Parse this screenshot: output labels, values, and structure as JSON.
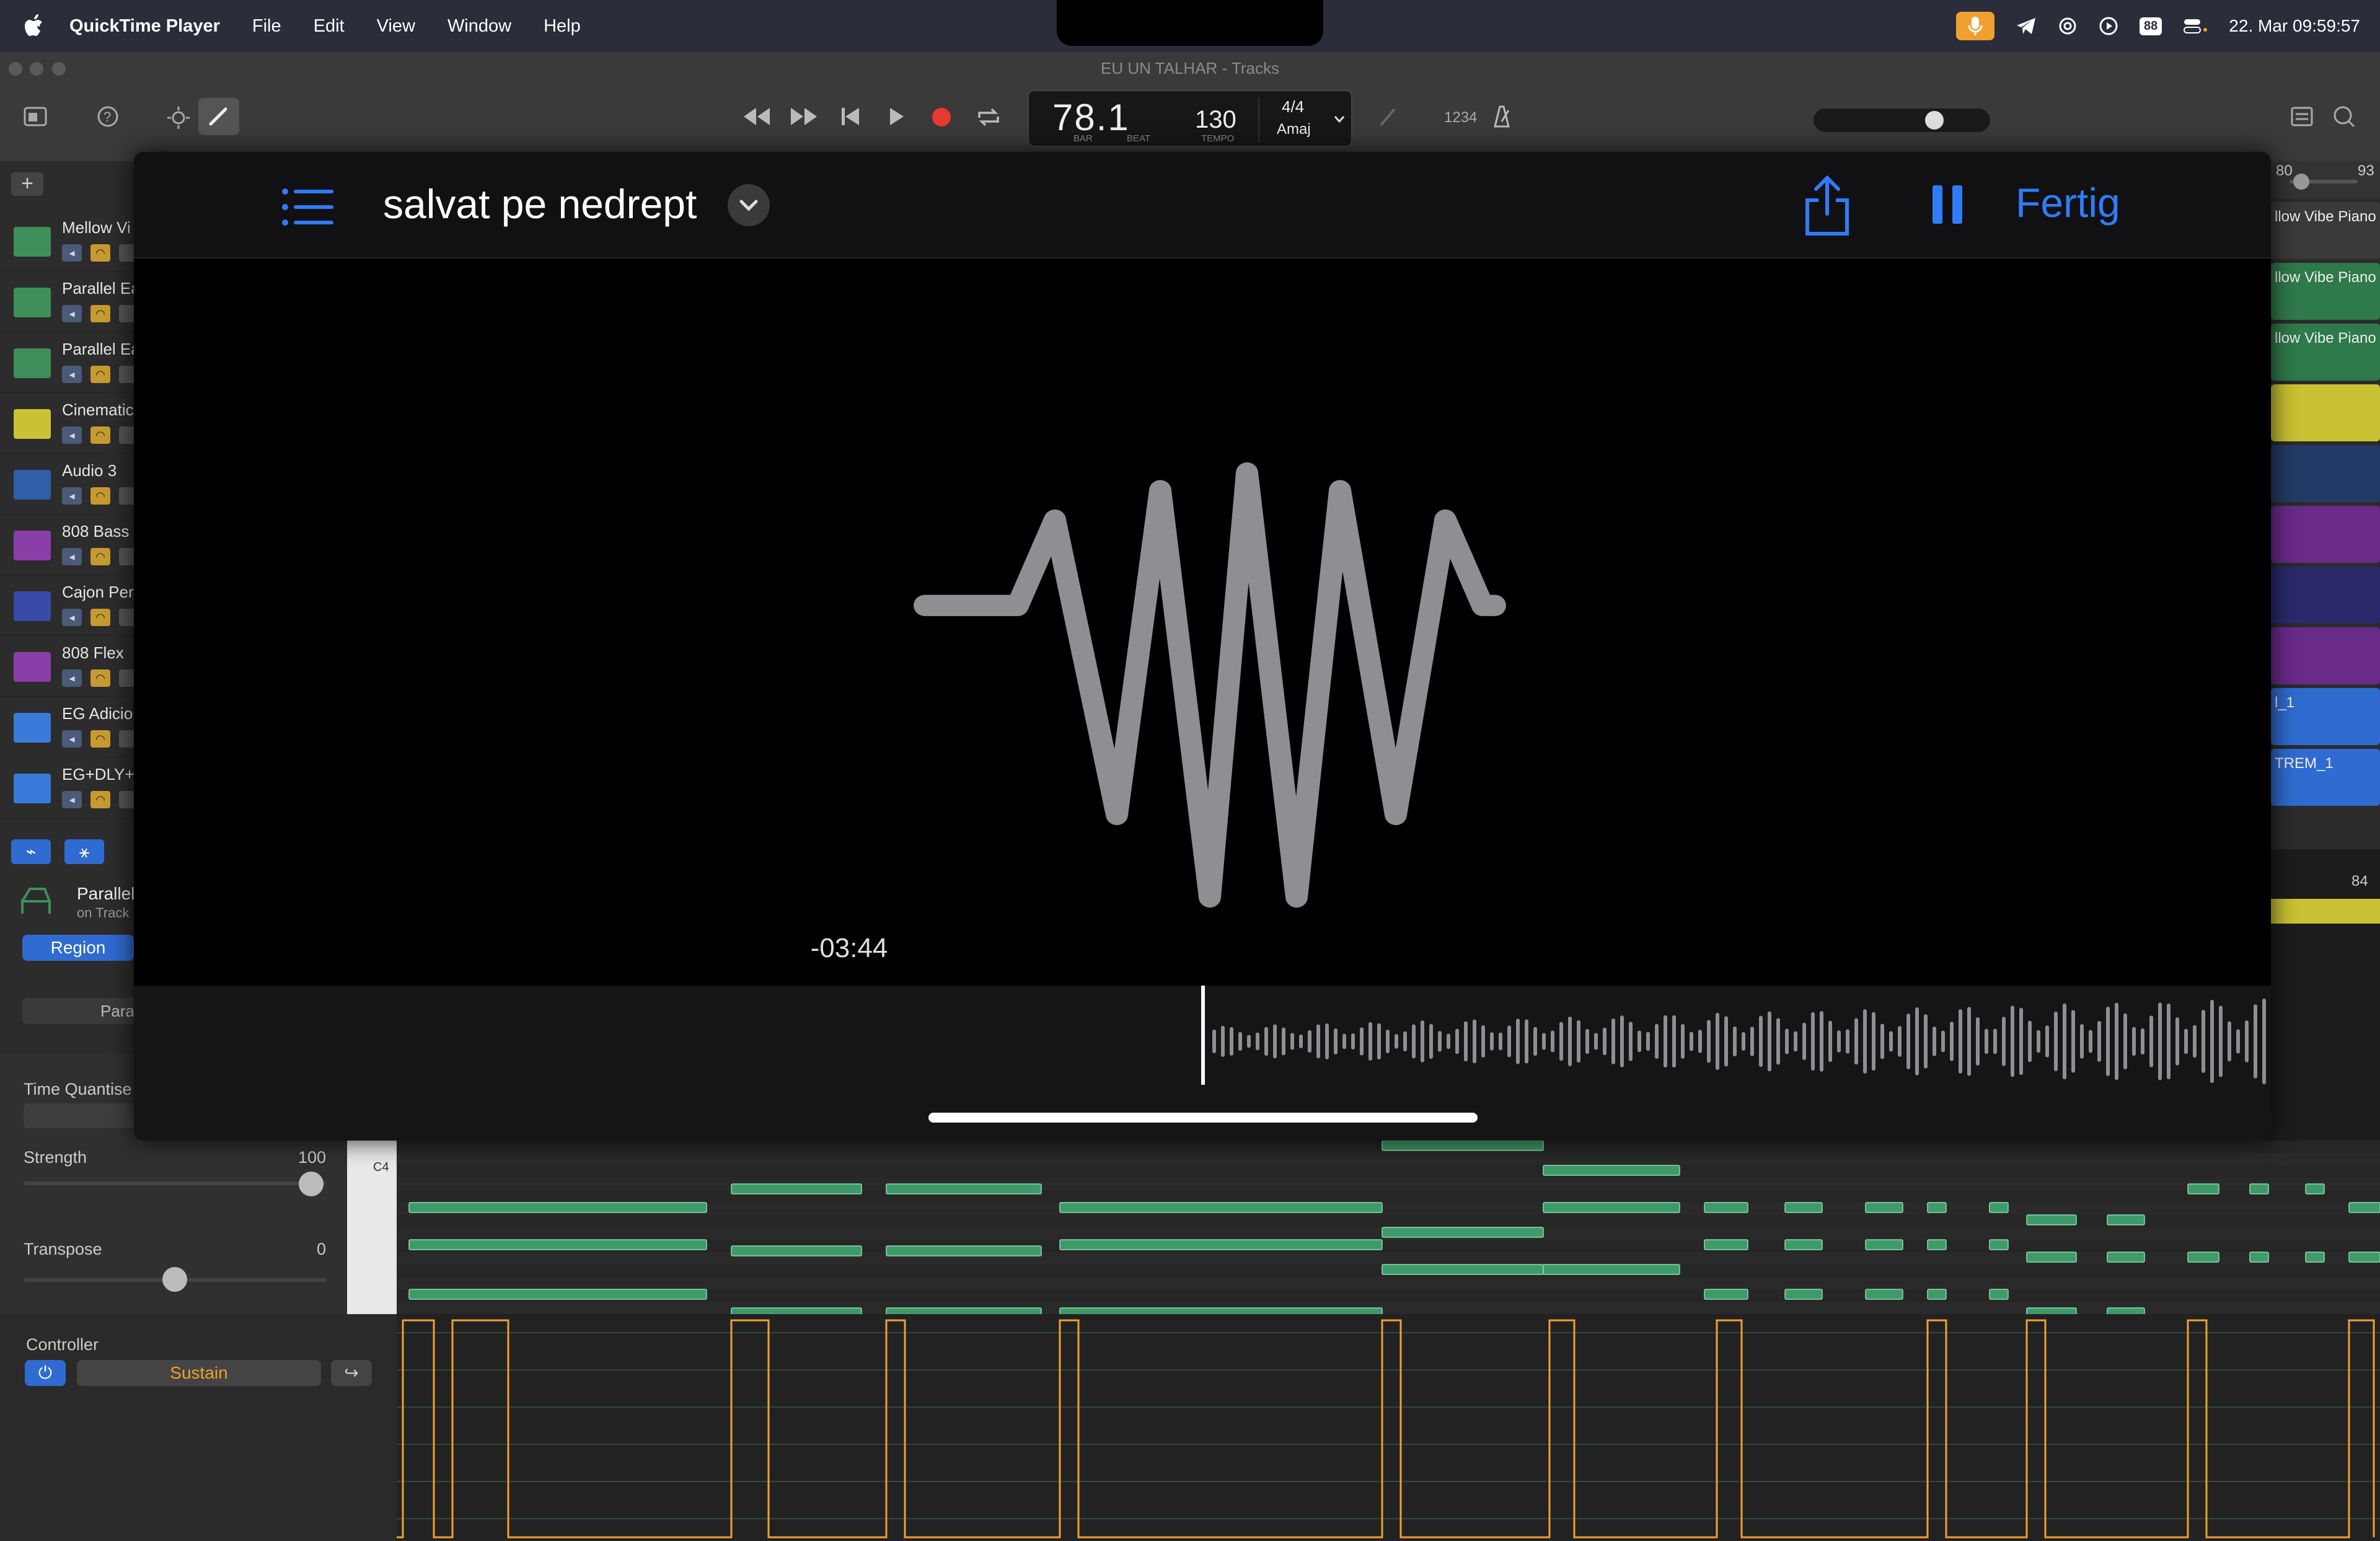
{
  "menubar": {
    "app_name": "QuickTime Player",
    "items": [
      "File",
      "Edit",
      "View",
      "Window",
      "Help"
    ],
    "status": {
      "battery_badge": "88",
      "datetime": "22. Mar  09:59:57"
    }
  },
  "window": {
    "title": "EU UN TALHAR - Tracks"
  },
  "lcd": {
    "position": "78.1",
    "bar_label": "BAR",
    "beat_label": "BEAT",
    "tempo": "130",
    "tempo_label": "TEMPO",
    "signature": "4/4",
    "key": "Amaj"
  },
  "toolbar": {
    "count_in": "1234"
  },
  "tracks": [
    {
      "name": "Mellow Vi",
      "color": "#3f8f5a"
    },
    {
      "name": "Parallel Ea",
      "color": "#3f8f5a"
    },
    {
      "name": "Parallel Ea",
      "color": "#3f8f5a"
    },
    {
      "name": "Cinematic",
      "color": "#c9c234"
    },
    {
      "name": "Audio 3",
      "color": "#2f5fa8"
    },
    {
      "name": "808 Bass",
      "color": "#8a3ea8"
    },
    {
      "name": "Cajon Per",
      "color": "#3a4aa8"
    },
    {
      "name": "808 Flex",
      "color": "#8a3ea8"
    },
    {
      "name": "EG Adicio",
      "color": "#3a7ad8"
    },
    {
      "name": "EG+DLY+",
      "color": "#3a7ad8"
    }
  ],
  "arrange": {
    "ruler_left": "80",
    "ruler_right": "93",
    "regions": [
      {
        "label": "llow Vibe Piano",
        "color": "#3a3a3a"
      },
      {
        "label": "llow Vibe Piano",
        "color": "#2f7a4a"
      },
      {
        "label": "llow Vibe Piano",
        "color": "#2f7a4a"
      },
      {
        "label": "",
        "color": "#c9c234"
      },
      {
        "label": "",
        "color": "#243a66"
      },
      {
        "label": "",
        "color": "#6a2a8a"
      },
      {
        "label": "",
        "color": "#2a2a6a"
      },
      {
        "label": "",
        "color": "#6a2a8a"
      },
      {
        "label": "l_1",
        "color": "#2f6bd1"
      },
      {
        "label": "TREM_1",
        "color": "#2f6bd1"
      }
    ],
    "bar_84": "84"
  },
  "inspector": {
    "region_name": "Parallel",
    "region_sub": "on Track",
    "region_button": "Region",
    "params_label": "Para"
  },
  "settings": {
    "time_quantise": "Time Quantise",
    "strength_label": "Strength",
    "strength_value": "100",
    "transpose_label": "Transpose",
    "transpose_value": "0",
    "note_label": "C4"
  },
  "controller": {
    "label": "Controller",
    "selected": "Sustain"
  },
  "quicktime": {
    "title": "salvat pe nedrept",
    "done_label": "Fertig",
    "remaining_time": "-03:44",
    "accent": "#2f7cf6"
  }
}
